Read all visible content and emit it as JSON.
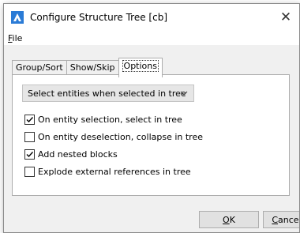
{
  "window": {
    "title": "Configure Structure Tree [cb]",
    "close_glyph": "✕",
    "icon": "app-logo-icon"
  },
  "menu": {
    "file_mnemonic": "F",
    "file_rest": "ile"
  },
  "tabs": [
    {
      "label": "Group/Sort",
      "active": false
    },
    {
      "label": "Show/Skip",
      "active": false
    },
    {
      "label": "Options",
      "active": true
    }
  ],
  "options": {
    "selection_mode": "Select entities when selected in tree",
    "checkboxes": [
      {
        "label": "On entity selection, select in tree",
        "checked": true
      },
      {
        "label": "On entity deselection, collapse in tree",
        "checked": false
      },
      {
        "label": "Add nested blocks",
        "checked": true
      },
      {
        "label": "Explode external references in tree",
        "checked": false
      }
    ]
  },
  "buttons": {
    "ok_mnemonic": "O",
    "ok_rest": "K",
    "cancel_mnemonic": "C",
    "cancel_rest": "ancel"
  },
  "colors": {
    "accent_blue": "#2a7bd6",
    "dialog_bg": "#f0f0f0"
  }
}
